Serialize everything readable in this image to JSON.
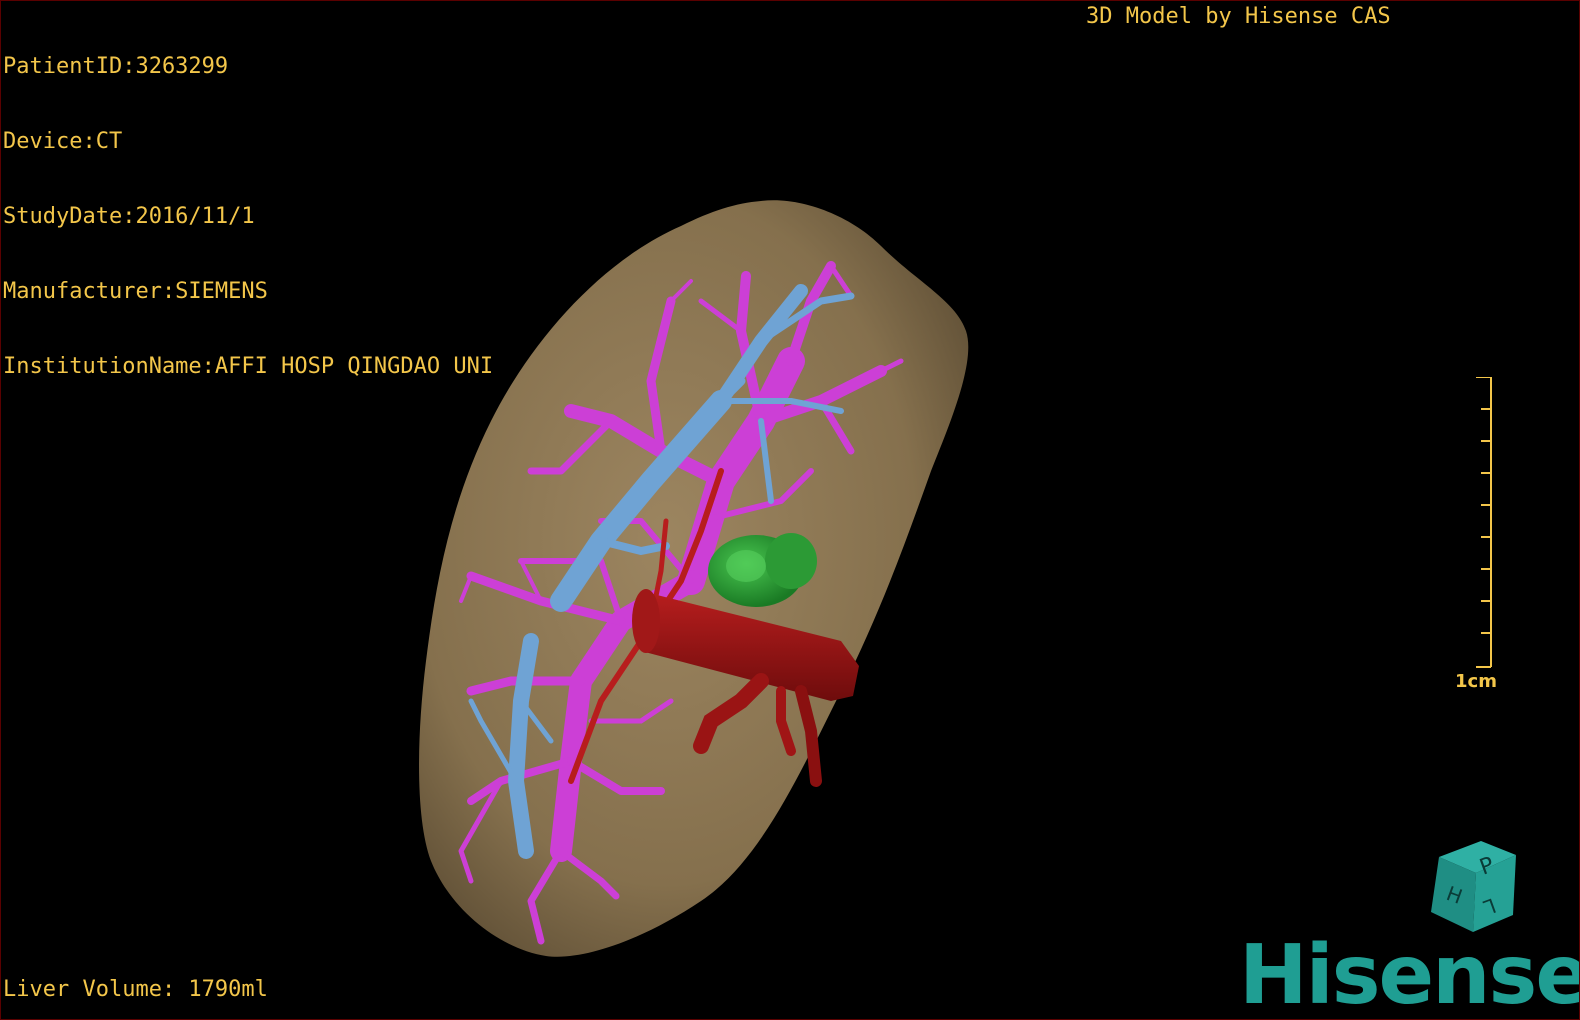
{
  "patient_info": {
    "patient_id": "PatientID:3263299",
    "device": "Device:CT",
    "study_date": "StudyDate:2016/11/1",
    "manufacturer": "Manufacturer:SIEMENS",
    "institution": "InstitutionName:AFFI HOSP QINGDAO UNI"
  },
  "model_credit": "3D Model by Hisense CAS",
  "liver_volume": "Liver Volume: 1790ml",
  "scale": {
    "label": "1cm"
  },
  "orientation_cube": {
    "face_top": "P",
    "face_left": "H",
    "face_right": "L"
  },
  "brand": {
    "name": "Hisense"
  },
  "colors": {
    "overlay_text": "#f3c64a",
    "liver": "#8f7550",
    "portal_vein": "#cc3fd6",
    "hepatic_vein": "#6fa3d4",
    "artery_vena_cava": "#9a1414",
    "lesion": "#2fa33a",
    "brand": "#1f9e93"
  }
}
